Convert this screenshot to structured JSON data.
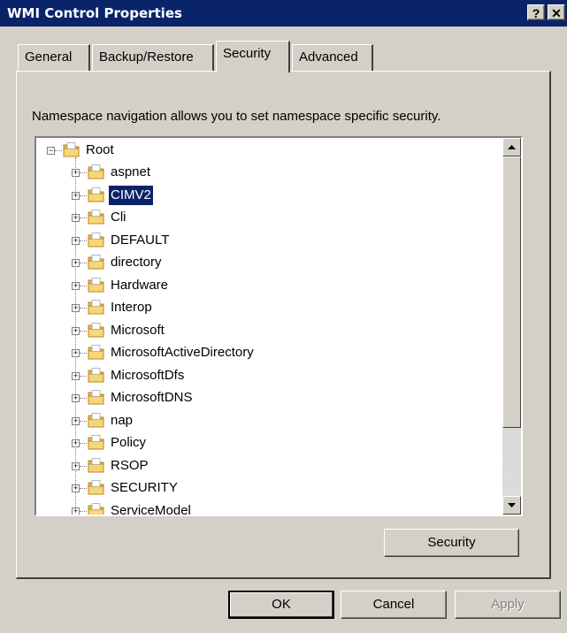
{
  "window": {
    "title": "WMI Control Properties",
    "help_glyph": "?",
    "close_glyph": "✕"
  },
  "tabs": [
    {
      "label": "General"
    },
    {
      "label": "Backup/Restore"
    },
    {
      "label": "Security",
      "active": true
    },
    {
      "label": "Advanced"
    }
  ],
  "security_tab": {
    "description": "Namespace navigation allows you to set namespace specific security.",
    "security_button": "Security"
  },
  "tree": {
    "root": "Root",
    "children": [
      "aspnet",
      "CIMV2",
      "Cli",
      "DEFAULT",
      "directory",
      "Hardware",
      "Interop",
      "Microsoft",
      "MicrosoftActiveDirectory",
      "MicrosoftDfs",
      "MicrosoftDNS",
      "nap",
      "Policy",
      "RSOP",
      "SECURITY",
      "ServiceModel"
    ],
    "selected": "CIMV2"
  },
  "footer": {
    "ok": "OK",
    "cancel": "Cancel",
    "apply": "Apply"
  },
  "colors": {
    "titlebar": "#0a246a",
    "face": "#d4d0c8",
    "selection": "#0a246a"
  }
}
